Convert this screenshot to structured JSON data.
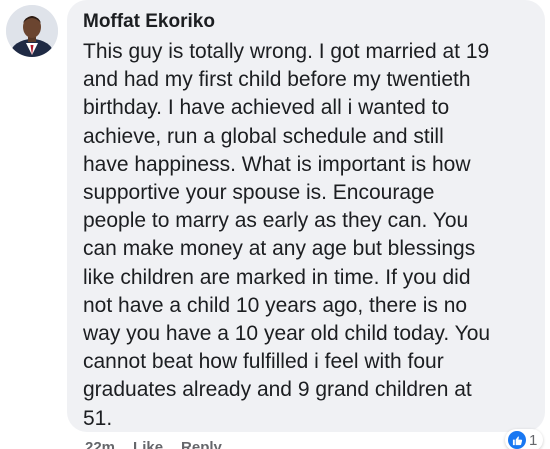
{
  "comment": {
    "author": "Moffat Ekoriko",
    "text": "This guy is totally wrong. I got married at 19\nand had my first child before my twentieth\nbirthday. I have achieved all i wanted to\nachieve, run  a global schedule and still\nhave happiness. What is important is how\nsupportive your spouse is. Encourage\npeople to marry as early as they can. You\ncan make money at any age but blessings\nlike children are marked in time. If you did\nnot have a child 10 years ago, there is no\nway you have a 10 year old child today. You\ncannot beat how fulfilled i feel with four\ngraduates already and 9 grand children at\n51.",
    "avatar_icon": "user-avatar-photo"
  },
  "meta": {
    "time": "22m",
    "like_label": "Like",
    "reply_label": "Reply"
  },
  "reactions": {
    "icon": "thumbs-up-icon",
    "count": "1",
    "color": "#1877f2"
  }
}
